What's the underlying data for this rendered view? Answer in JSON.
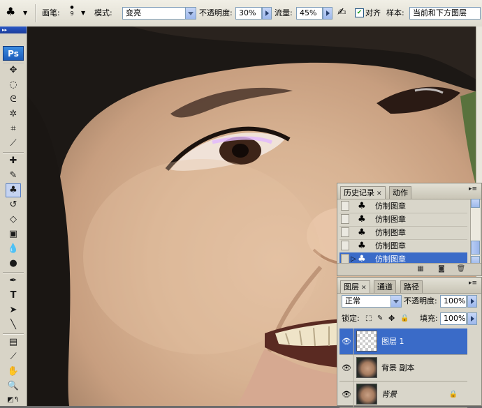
{
  "options_bar": {
    "brush_label": "画笔:",
    "brush_size": "9",
    "mode_label": "模式:",
    "mode_value": "变亮",
    "opacity_label": "不透明度:",
    "opacity_value": "30%",
    "flow_label": "流量:",
    "flow_value": "45%",
    "aligned_label": "对齐",
    "aligned_checked": true,
    "sample_label": "样本:",
    "sample_value": "当前和下方图层"
  },
  "toolbox": {
    "logo": "Ps",
    "selected_tool": "clone-stamp-tool"
  },
  "history_panel": {
    "tabs": [
      "历史记录",
      "动作"
    ],
    "items": [
      {
        "label": "仿制图章"
      },
      {
        "label": "仿制图章"
      },
      {
        "label": "仿制图章"
      },
      {
        "label": "仿制图章"
      },
      {
        "label": "仿制图章",
        "selected": true
      }
    ]
  },
  "layers_panel": {
    "tabs": [
      "图层",
      "通道",
      "路径"
    ],
    "blend_mode": "正常",
    "opacity_label": "不透明度:",
    "opacity_value": "100%",
    "lock_label": "锁定:",
    "fill_label": "填充:",
    "fill_value": "100%",
    "layers": [
      {
        "name": "图层 1",
        "selected": true
      },
      {
        "name": "背景 副本",
        "selected": false
      },
      {
        "name": "背景",
        "selected": false,
        "locked": true
      }
    ]
  },
  "colors": {
    "selection": "#3a6bc8",
    "panel_bg": "#d9d6ca",
    "toolbar_bg": "#dedbcf"
  }
}
